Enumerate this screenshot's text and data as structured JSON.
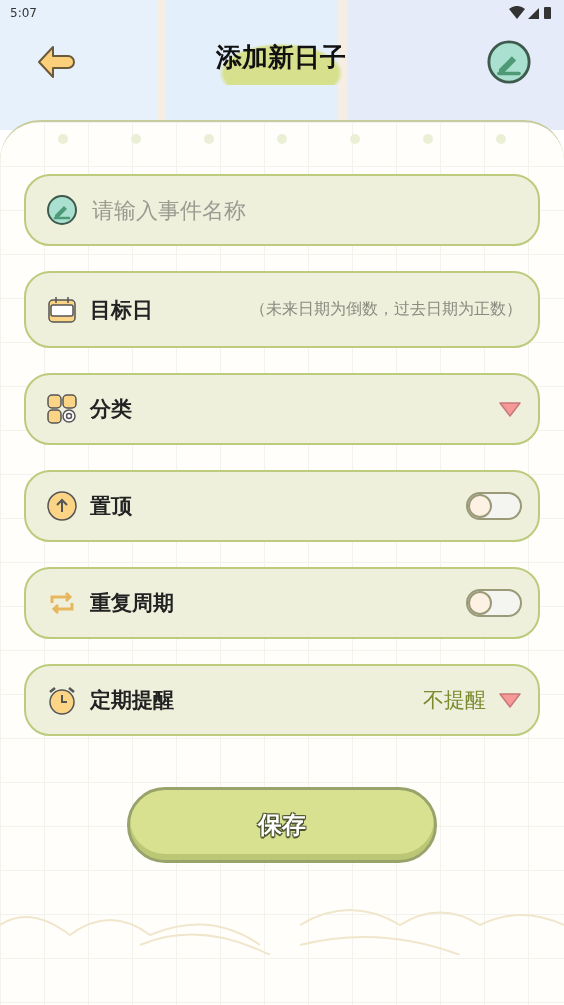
{
  "status_bar": {
    "time": "5:07"
  },
  "header": {
    "title": "添加新日子"
  },
  "name_field": {
    "placeholder": "请输入事件名称"
  },
  "rows": [
    {
      "kind": "date",
      "label": "目标日",
      "hint": "（未来日期为倒数，过去日期为正数）"
    },
    {
      "kind": "select",
      "label": "分类"
    },
    {
      "kind": "toggle",
      "label": "置顶",
      "on": false
    },
    {
      "kind": "toggle",
      "label": "重复周期",
      "on": false
    },
    {
      "kind": "select",
      "label": "定期提醒",
      "value": "不提醒"
    }
  ],
  "save_button": "保存"
}
